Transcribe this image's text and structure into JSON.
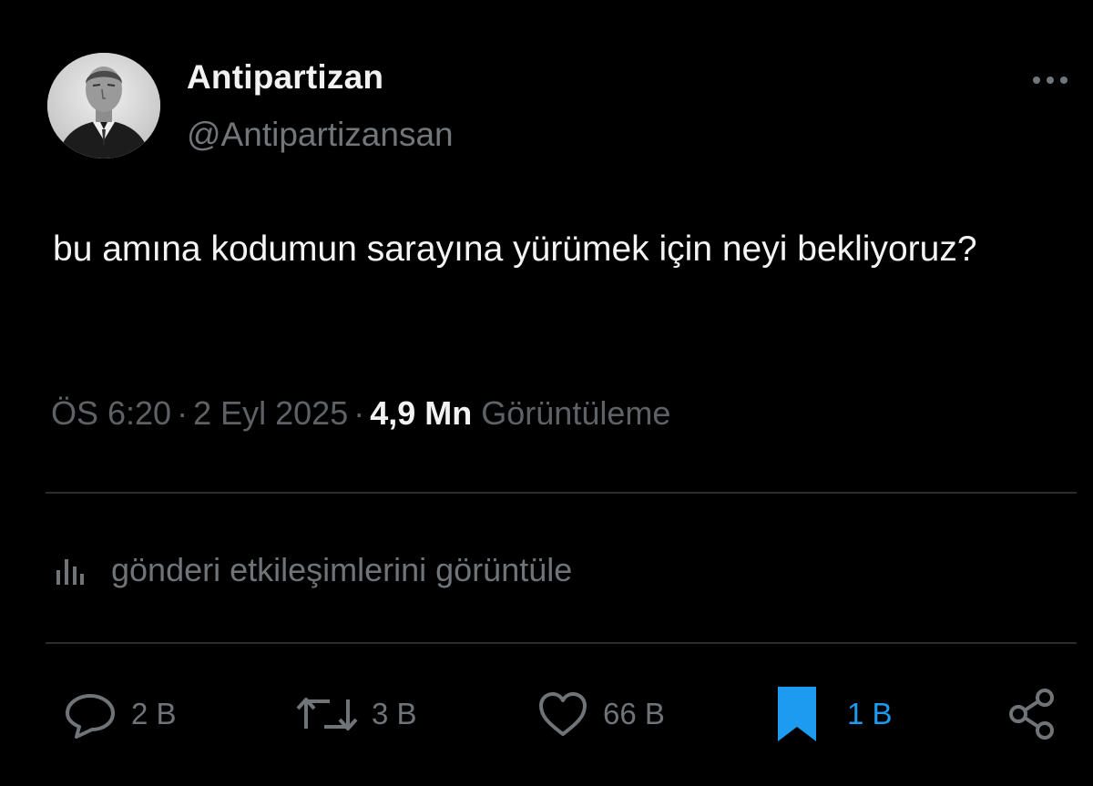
{
  "author": {
    "display_name": "Antipartizan",
    "handle": "@Antipartizansan",
    "avatar_icon": "profile-photo-portrait"
  },
  "more_icon": "ellipsis-icon",
  "tweet": {
    "text": "bu amına kodumun sarayına yürümek için neyi bekliyoruz?"
  },
  "meta": {
    "time": "ÖS 6:20",
    "separator": "·",
    "date": "2 Eyl 2025",
    "views_count": "4,9 Mn",
    "views_label": "Görüntüleme"
  },
  "analytics": {
    "label": "gönderi etkileşimlerini görüntüle",
    "icon": "bar-chart-icon"
  },
  "actions": {
    "reply_count": "2 B",
    "retweet_count": "3 B",
    "like_count": "66 B",
    "bookmark_count": "1 B",
    "share_icon": "share-icon"
  },
  "colors": {
    "background": "#000000",
    "primary_text": "#f4f4f4",
    "secondary_text": "#71767b",
    "divider": "#2a2d30",
    "accent": "#1d9bf0"
  }
}
